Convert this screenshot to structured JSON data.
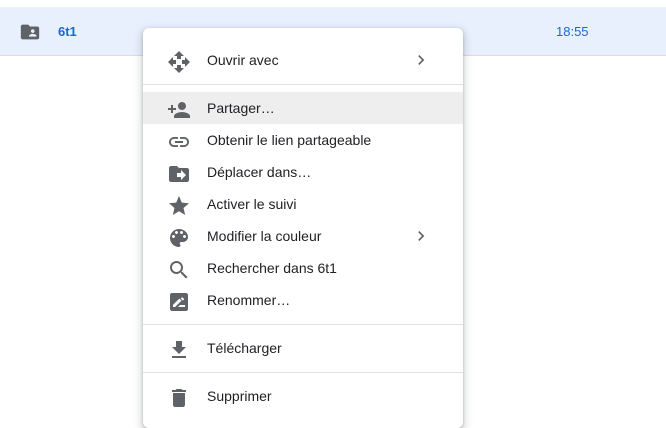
{
  "file_row": {
    "name": "6t1",
    "time": "18:55",
    "icon": "shared-folder-icon"
  },
  "context_menu": {
    "items": [
      {
        "label": "Ouvrir avec",
        "icon": "open-with-icon",
        "has_submenu": true
      },
      {
        "label": "Partager…",
        "icon": "person-add-icon",
        "highlighted": true
      },
      {
        "label": "Obtenir le lien partageable",
        "icon": "link-icon"
      },
      {
        "label": "Déplacer dans…",
        "icon": "move-to-folder-icon"
      },
      {
        "label": "Activer le suivi",
        "icon": "star-icon"
      },
      {
        "label": "Modifier la couleur",
        "icon": "palette-icon",
        "has_submenu": true
      },
      {
        "label": "Rechercher dans 6t1",
        "icon": "search-icon"
      },
      {
        "label": "Renommer…",
        "icon": "rename-icon"
      },
      {
        "label": "Télécharger",
        "icon": "download-icon"
      },
      {
        "label": "Supprimer",
        "icon": "trash-icon"
      }
    ]
  },
  "colors": {
    "selected_row_bg": "#e8f0fe",
    "accent": "#1967d2",
    "icon_gray": "#5f6368",
    "hover_bg": "#eeeeee"
  }
}
